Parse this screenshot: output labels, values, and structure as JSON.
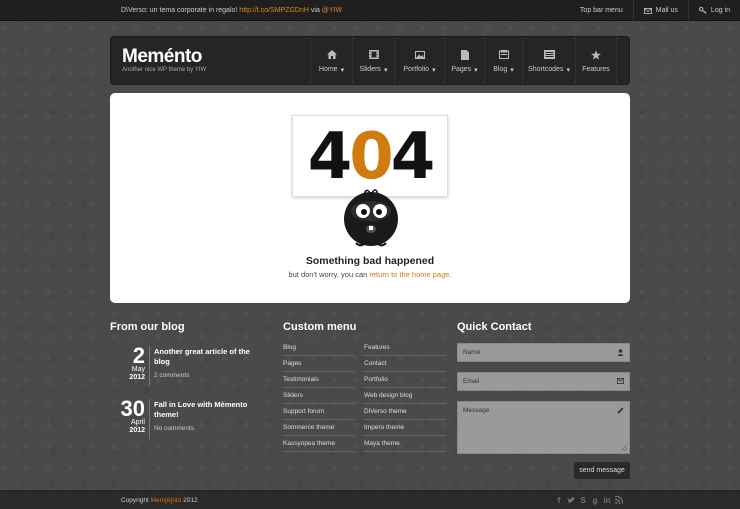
{
  "topbar": {
    "tweet_text": "D\\Verso: un tema corporate in regalo!",
    "tweet_link": "http://t.co/SMPZGDnH",
    "tweet_via": "via",
    "tweet_user": "@YIW",
    "menu_label": "Top bar menu",
    "mail_label": "Mail us",
    "login_label": "Log in"
  },
  "header": {
    "logo_prefix": "Mem",
    "logo_accent": "é",
    "logo_suffix": "nto",
    "tagline": "Another nice WP theme by YIW"
  },
  "nav": [
    {
      "label": "Home",
      "icon": "home-icon",
      "dropdown": true
    },
    {
      "label": "Sliders",
      "icon": "film-icon",
      "dropdown": true
    },
    {
      "label": "Portfolio",
      "icon": "image-icon",
      "dropdown": true
    },
    {
      "label": "Pages",
      "icon": "page-icon",
      "dropdown": true
    },
    {
      "label": "Blog",
      "icon": "blog-icon",
      "dropdown": true
    },
    {
      "label": "Shortcodes",
      "icon": "shortcodes-icon",
      "dropdown": true
    },
    {
      "label": "Features",
      "icon": "star-icon",
      "dropdown": false
    }
  ],
  "error": {
    "digit1": "4",
    "digit2": "0",
    "digit3": "4",
    "title": "Something bad happened",
    "sub_before": "but don't worry, you can",
    "sub_link": "return to the home page."
  },
  "blog_widget": {
    "title": "From our blog",
    "posts": [
      {
        "day": "2",
        "month": "May",
        "year": "2012",
        "title": "Another great article of the blog",
        "comments": "2 comments"
      },
      {
        "day": "30",
        "month": "April",
        "year": "2012",
        "title": "Fall in Love with Mèmento theme!",
        "comments": "No comments"
      }
    ]
  },
  "menu_widget": {
    "title": "Custom menu",
    "col1": [
      "Blog",
      "Pages",
      "Testimonials",
      "Sliders",
      "Support forum",
      "Sommerce theme",
      "Kassyopea theme"
    ],
    "col2": [
      "Features",
      "Contact",
      "Portfolio",
      "Web design blog",
      "DiVerso theme",
      "Impero theme",
      "Maya theme"
    ]
  },
  "contact_widget": {
    "title": "Quick Contact",
    "name_placeholder": "Name",
    "email_placeholder": "Email",
    "message_placeholder": "Message",
    "send_label": "send message"
  },
  "footer": {
    "copyright_prefix": "Copyright",
    "brand": "Mem[é]nto",
    "year": "2012",
    "social": [
      "facebook-icon",
      "twitter-icon",
      "skype-icon",
      "google-icon",
      "linkedin-icon",
      "rss-icon"
    ]
  },
  "colors": {
    "accent": "#d07b0d",
    "background": "#4a4a4a",
    "topbar": "#1f1f1f"
  }
}
